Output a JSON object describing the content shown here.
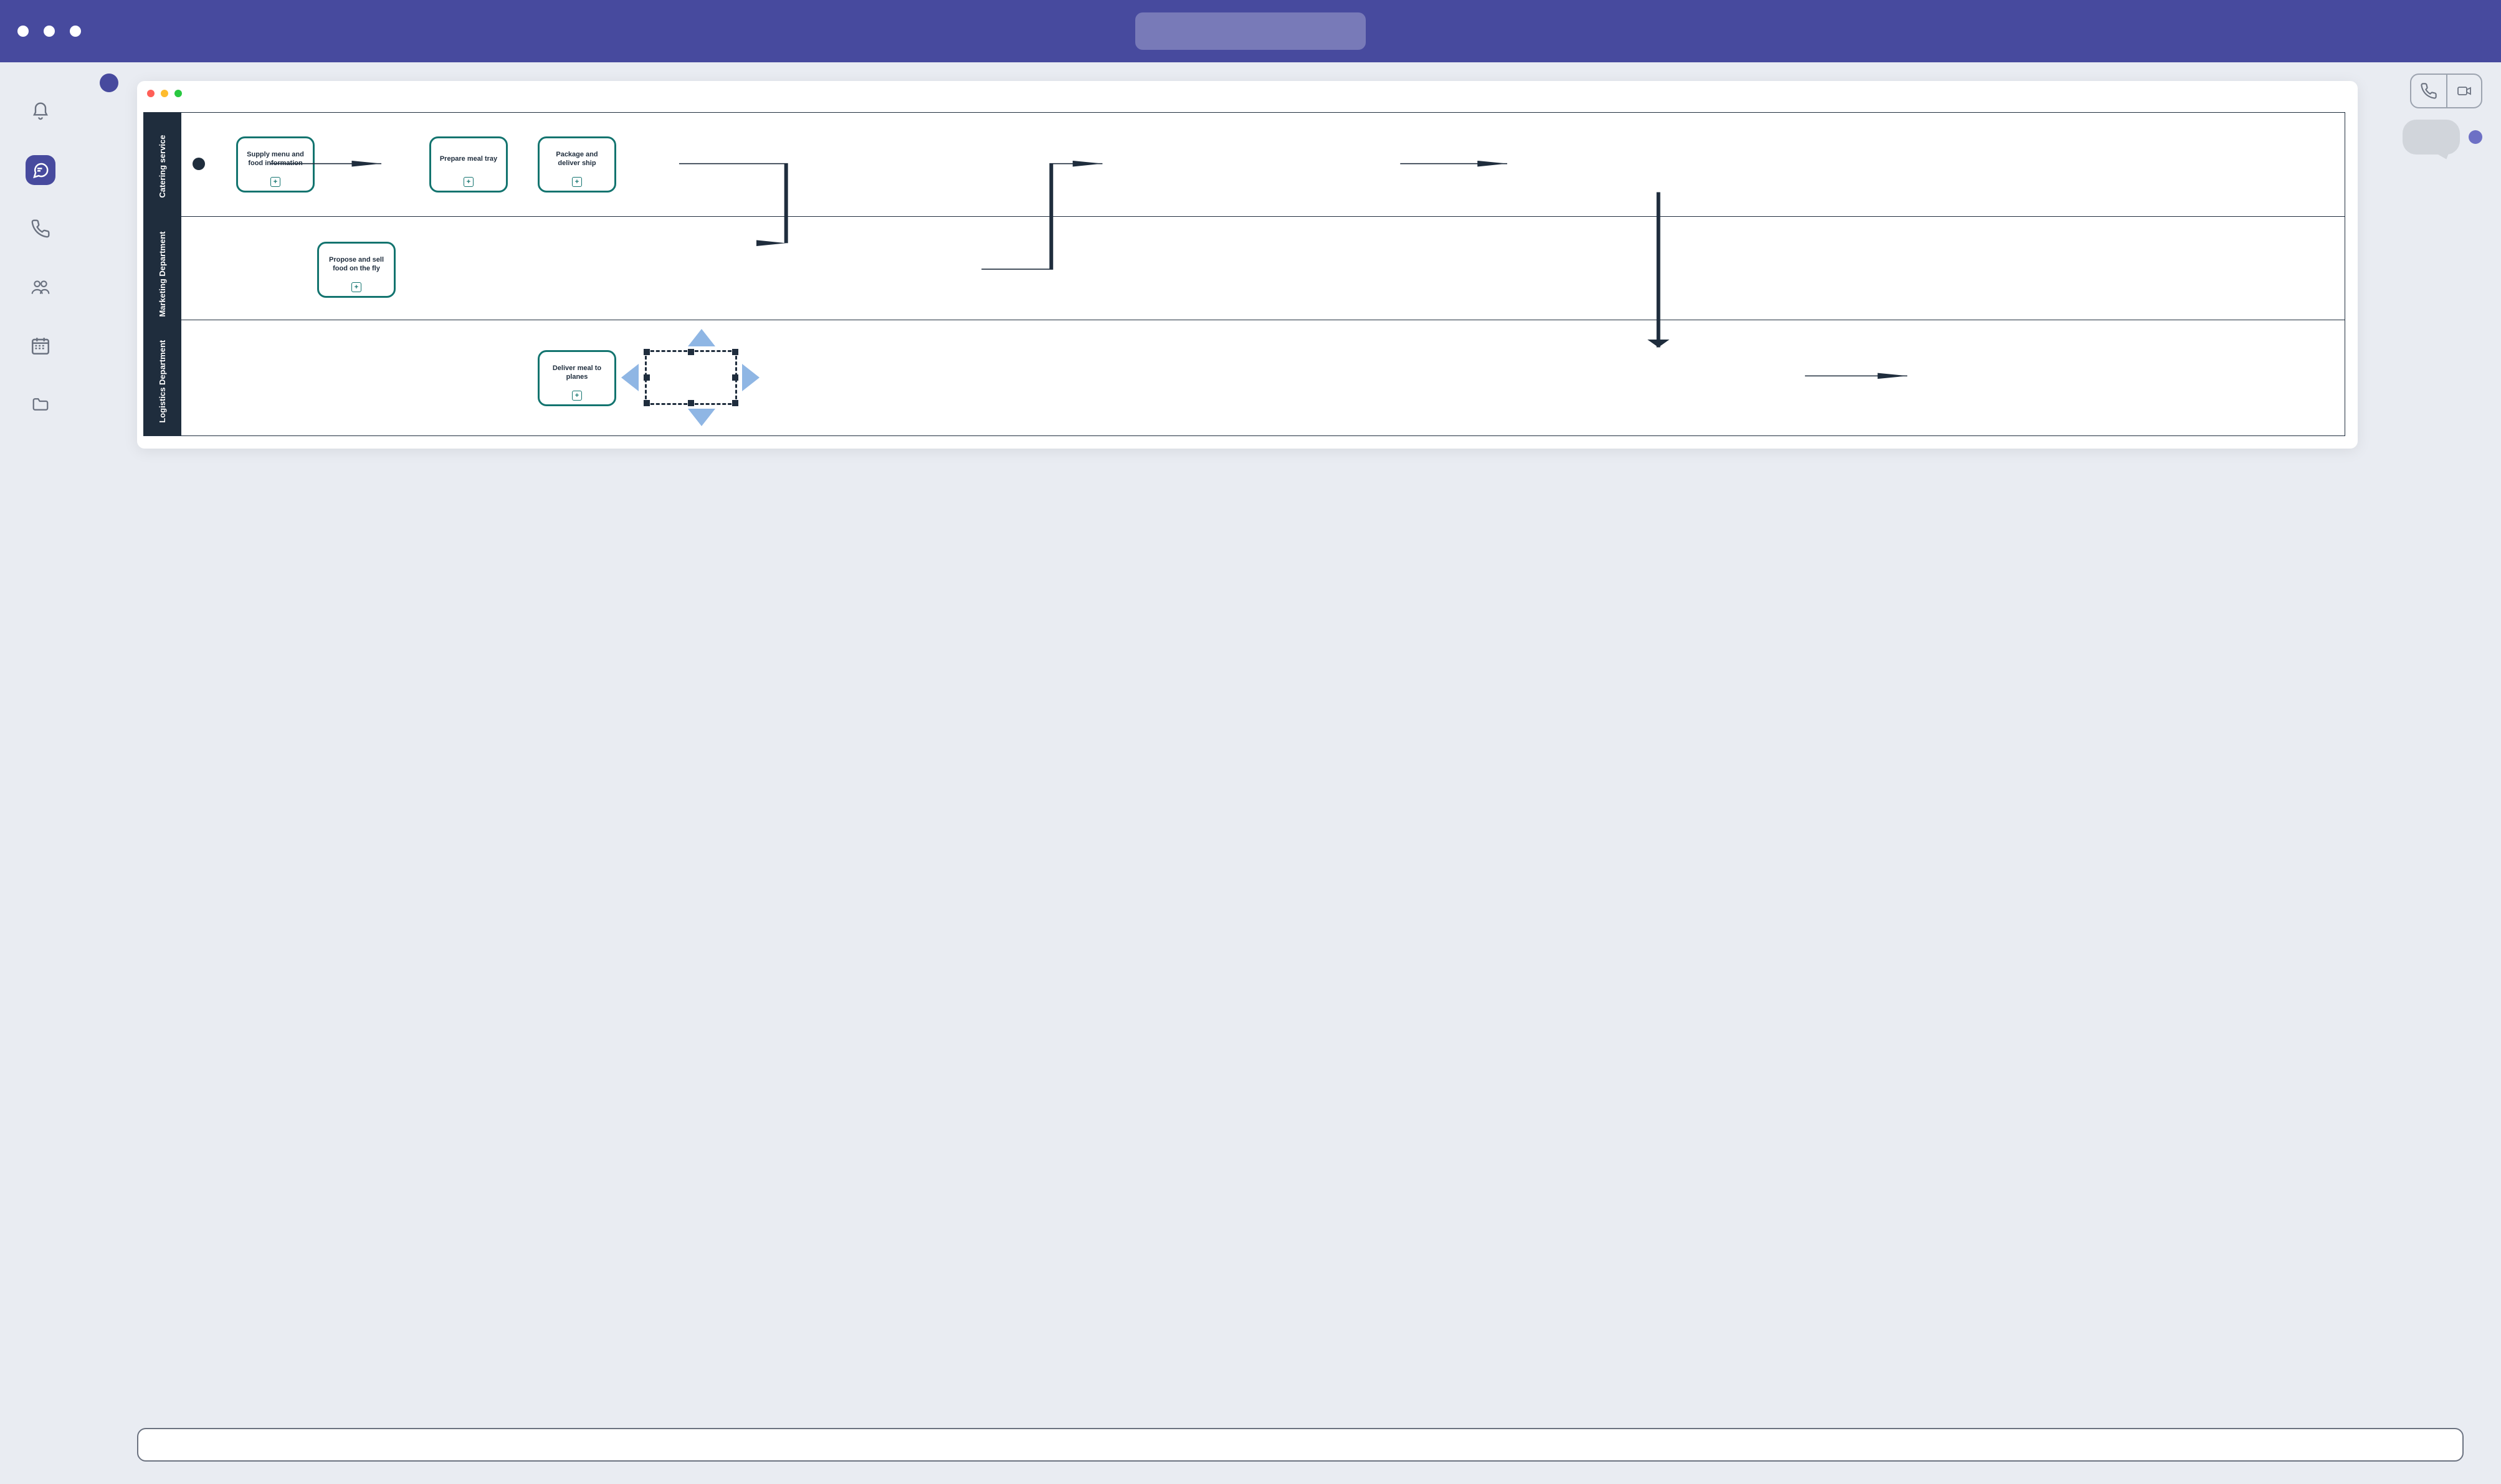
{
  "colors": {
    "brand": "#474a9e",
    "task_border": "#13746f",
    "lane_header": "#1f2d3d",
    "selection_arrow": "#8fb6e4"
  },
  "diagram": {
    "lanes": [
      {
        "name": "Catering service"
      },
      {
        "name": "Marketing Department"
      },
      {
        "name": "Logistics Department"
      }
    ],
    "tasks": {
      "supply": {
        "label": "Supply menu and food information",
        "marker": "+"
      },
      "prepare": {
        "label": "Prepare meal tray",
        "marker": "+"
      },
      "package": {
        "label": "Package and deliver ship",
        "marker": "+"
      },
      "propose": {
        "label": "Propose and sell food on the fly",
        "marker": "+"
      },
      "deliver": {
        "label": "Deliver meal to planes",
        "marker": "+"
      }
    }
  }
}
